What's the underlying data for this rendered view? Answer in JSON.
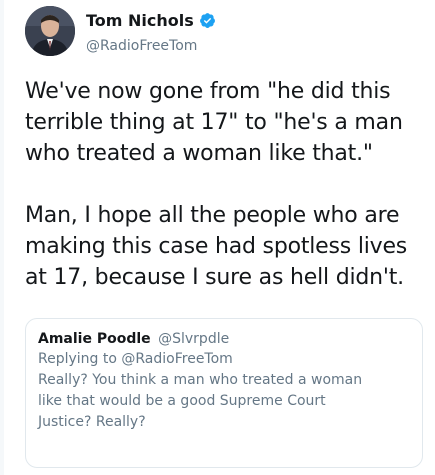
{
  "author": {
    "display_name": "Tom Nichols",
    "handle": "@RadioFreeTom",
    "verified": true,
    "avatar_icon": "profile-photo",
    "verified_icon": "verified-badge-icon"
  },
  "tweet": {
    "paragraphs": [
      "We've now gone from \"he did this\nterrible thing at 17\" to \"he's a man\nwho treated a woman like that.\"",
      "Man, I hope all the people who are\nmaking this case had spotless lives\nat 17, because I sure as hell didn't."
    ]
  },
  "quoted_tweet": {
    "display_name": "Amalie Poodle",
    "handle": "@Slvrpdle",
    "replying_to": "Replying to @RadioFreeTom",
    "text": "Really?  You think a man who treated a woman\nlike that would be a good Supreme Court\nJustice? Really?"
  },
  "colors": {
    "primary_text": "#14171a",
    "secondary_text": "#657786",
    "verified_blue": "#1da1f2",
    "border": "#e1e8ed"
  }
}
